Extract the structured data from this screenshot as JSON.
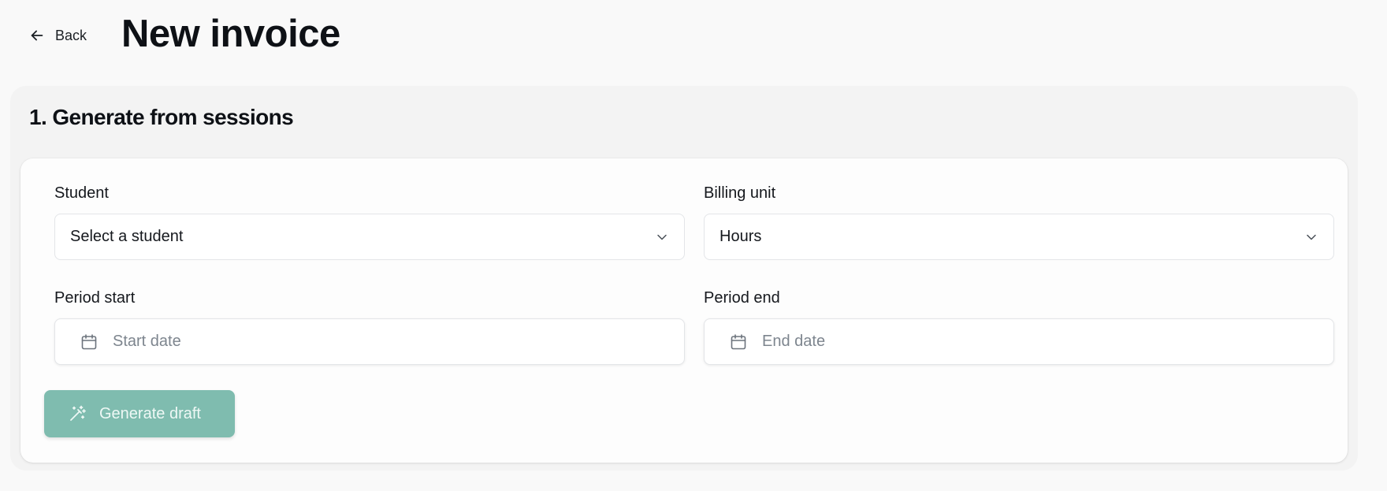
{
  "header": {
    "back_label": "Back",
    "title": "New invoice"
  },
  "section": {
    "title": "1. Generate from sessions"
  },
  "form": {
    "student": {
      "label": "Student",
      "value": "Select a student"
    },
    "billing_unit": {
      "label": "Billing unit",
      "value": "Hours"
    },
    "period_start": {
      "label": "Period start",
      "placeholder": "Start date"
    },
    "period_end": {
      "label": "Period end",
      "placeholder": "End date"
    },
    "generate_label": "Generate draft"
  },
  "colors": {
    "page_background": "#f9f9f9",
    "section_background": "#f3f3f3",
    "panel_background": "#fdfdfd",
    "primary_button": "#7fbcaf",
    "placeholder_text": "#7d858e"
  },
  "icons": {
    "back": "arrow-left-icon",
    "dropdown": "chevron-down-icon",
    "date": "calendar-icon",
    "generate": "magic-wand-icon"
  }
}
